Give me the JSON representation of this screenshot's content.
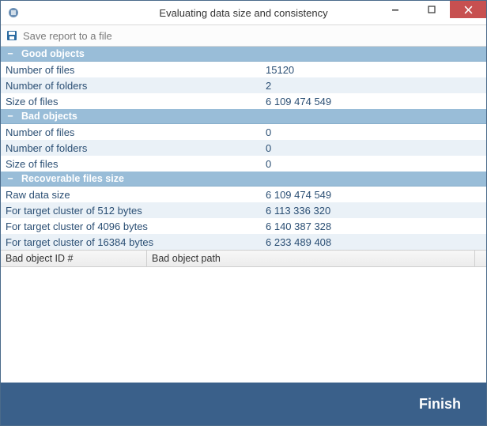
{
  "window": {
    "title": "Evaluating data size and consistency"
  },
  "toolbar": {
    "save_label": "Save report to a file"
  },
  "sections": {
    "good": {
      "title": "Good objects",
      "rows": {
        "files_label": "Number of files",
        "files_value": "15120",
        "folders_label": "Number of folders",
        "folders_value": "2",
        "size_label": "Size of files",
        "size_value": "6 109 474 549"
      }
    },
    "bad": {
      "title": "Bad objects",
      "rows": {
        "files_label": "Number of files",
        "files_value": "0",
        "folders_label": "Number of folders",
        "folders_value": "0",
        "size_label": "Size of files",
        "size_value": "0"
      }
    },
    "recoverable": {
      "title": "Recoverable files size",
      "rows": {
        "raw_label": "Raw data size",
        "raw_value": "6 109 474 549",
        "c512_label": "For target cluster of 512 bytes",
        "c512_value": "6 113 336 320",
        "c4096_label": "For target cluster of 4096 bytes",
        "c4096_value": "6 140 387 328",
        "c16384_label": "For target cluster of 16384 bytes",
        "c16384_value": "6 233 489 408"
      }
    }
  },
  "grid": {
    "col_id": "Bad object ID #",
    "col_path": "Bad object path"
  },
  "footer": {
    "finish_label": "Finish"
  }
}
